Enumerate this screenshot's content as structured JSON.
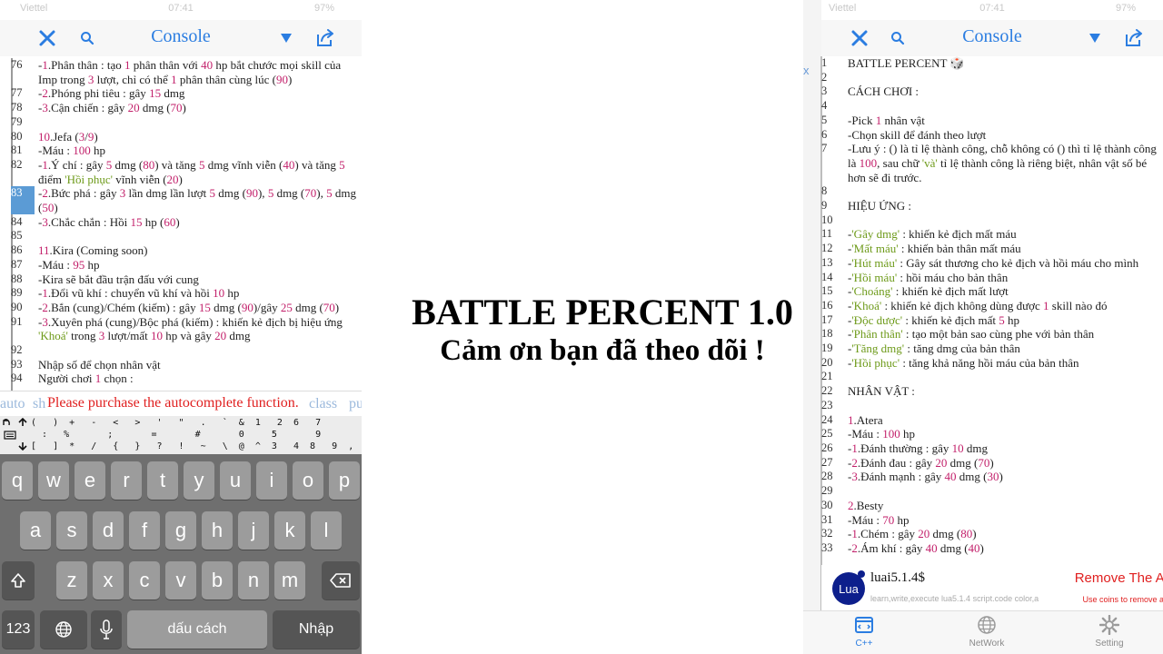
{
  "left": {
    "status": {
      "carrier": "Viettel",
      "time": "07:41",
      "battery": "97%"
    },
    "title": "Console",
    "lines": [
      {
        "n": "76",
        "parts": [
          [
            "-",
            ""
          ],
          [
            "1",
            "num"
          ],
          [
            ".Phân thân : tạo ",
            ""
          ],
          [
            "1",
            "num"
          ],
          [
            " phân thân với ",
            ""
          ],
          [
            "40",
            "num"
          ],
          [
            " hp bắt chước mọi skill của Imp trong ",
            ""
          ],
          [
            "3",
            "num"
          ],
          [
            " lượt, chỉ có thể ",
            ""
          ],
          [
            "1",
            "num"
          ],
          [
            " phân thân cùng lúc (",
            ""
          ],
          [
            "90",
            "num"
          ],
          [
            ")",
            ""
          ]
        ]
      },
      {
        "n": "77",
        "parts": [
          [
            "-",
            ""
          ],
          [
            "2",
            "num"
          ],
          [
            ".Phóng phi tiêu : gây ",
            ""
          ],
          [
            "15",
            "num"
          ],
          [
            " dmg",
            ""
          ]
        ]
      },
      {
        "n": "78",
        "parts": [
          [
            "-",
            ""
          ],
          [
            "3",
            "num"
          ],
          [
            ".Cận chiến : gây ",
            ""
          ],
          [
            "20",
            "num"
          ],
          [
            " dmg (",
            ""
          ],
          [
            "70",
            "num"
          ],
          [
            ")",
            ""
          ]
        ]
      },
      {
        "n": "79",
        "parts": []
      },
      {
        "n": "80",
        "parts": [
          [
            "10",
            "num"
          ],
          [
            ".Jefa (",
            ""
          ],
          [
            "3",
            "num"
          ],
          [
            "/",
            ""
          ],
          [
            "9",
            "num"
          ],
          [
            ")",
            ""
          ]
        ]
      },
      {
        "n": "81",
        "parts": [
          [
            "-Máu : ",
            ""
          ],
          [
            "100",
            "num"
          ],
          [
            " hp",
            ""
          ]
        ]
      },
      {
        "n": "82",
        "parts": [
          [
            "-",
            ""
          ],
          [
            "1",
            "num"
          ],
          [
            ".Ý chí : gây ",
            ""
          ],
          [
            "5",
            "num"
          ],
          [
            " dmg (",
            ""
          ],
          [
            "80",
            "num"
          ],
          [
            ") và tăng ",
            ""
          ],
          [
            "5",
            "num"
          ],
          [
            " dmg vĩnh viễn (",
            ""
          ],
          [
            "40",
            "num"
          ],
          [
            ") và tăng ",
            ""
          ],
          [
            "5",
            "num"
          ],
          [
            " điểm ",
            ""
          ],
          [
            "'Hồi phục'",
            "str"
          ],
          [
            " vĩnh viễn (",
            ""
          ],
          [
            "20",
            "num"
          ],
          [
            ")",
            ""
          ]
        ]
      },
      {
        "n": "83",
        "hl": true,
        "parts": [
          [
            "-",
            ""
          ],
          [
            "2",
            "num"
          ],
          [
            ".Bức phá : gây ",
            ""
          ],
          [
            "3",
            "num"
          ],
          [
            " lần dmg lần lượt ",
            ""
          ],
          [
            "5",
            "num"
          ],
          [
            " dmg (",
            ""
          ],
          [
            "90",
            "num"
          ],
          [
            "), ",
            ""
          ],
          [
            "5",
            "num"
          ],
          [
            " dmg (",
            ""
          ],
          [
            "70",
            "num"
          ],
          [
            "), ",
            ""
          ],
          [
            "5",
            "num"
          ],
          [
            " dmg (",
            ""
          ],
          [
            "50",
            "num"
          ],
          [
            ")",
            ""
          ]
        ]
      },
      {
        "n": "84",
        "parts": [
          [
            "-",
            ""
          ],
          [
            "3",
            "num"
          ],
          [
            ".Chắc chắn : Hồi ",
            ""
          ],
          [
            "15",
            "num"
          ],
          [
            " hp (",
            ""
          ],
          [
            "60",
            "num"
          ],
          [
            ")",
            ""
          ]
        ]
      },
      {
        "n": "85",
        "parts": []
      },
      {
        "n": "86",
        "parts": [
          [
            "11",
            "num"
          ],
          [
            ".Kira (Coming soon)",
            ""
          ]
        ]
      },
      {
        "n": "87",
        "parts": [
          [
            "-Máu : ",
            ""
          ],
          [
            "95",
            "num"
          ],
          [
            " hp",
            ""
          ]
        ]
      },
      {
        "n": "88",
        "parts": [
          [
            "-Kira sẽ bắt đầu trận đấu với cung",
            ""
          ]
        ]
      },
      {
        "n": "89",
        "parts": [
          [
            "-",
            ""
          ],
          [
            "1",
            "num"
          ],
          [
            ".Đổi vũ khí : chuyển vũ khí và hồi ",
            ""
          ],
          [
            "10",
            "num"
          ],
          [
            " hp",
            ""
          ]
        ]
      },
      {
        "n": "90",
        "parts": [
          [
            "-",
            ""
          ],
          [
            "2",
            "num"
          ],
          [
            ".Bắn (cung)/Chém (kiếm) : gây ",
            ""
          ],
          [
            "15",
            "num"
          ],
          [
            " dmg (",
            ""
          ],
          [
            "90",
            "num"
          ],
          [
            ")/gây ",
            ""
          ],
          [
            "25",
            "num"
          ],
          [
            " dmg (",
            ""
          ],
          [
            "70",
            "num"
          ],
          [
            ")",
            ""
          ]
        ]
      },
      {
        "n": "91",
        "parts": [
          [
            "-",
            ""
          ],
          [
            "3",
            "num"
          ],
          [
            ".Xuyên phá (cung)/Bộc phá (kiếm) : khiến kẻ địch bị hiệu ứng ",
            ""
          ],
          [
            "'Khoá'",
            "str"
          ],
          [
            " trong ",
            ""
          ],
          [
            "3",
            "num"
          ],
          [
            " lượt/mất ",
            ""
          ],
          [
            "10",
            "num"
          ],
          [
            " hp và gây ",
            ""
          ],
          [
            "20",
            "num"
          ],
          [
            " dmg",
            ""
          ]
        ]
      },
      {
        "n": "92",
        "parts": []
      },
      {
        "n": "93",
        "parts": [
          [
            "Nhập số để chọn nhân vật",
            ""
          ]
        ]
      },
      {
        "n": "94",
        "parts": [
          [
            "Người chơi ",
            ""
          ],
          [
            "1",
            "num"
          ],
          [
            " chọn :",
            ""
          ]
        ]
      }
    ],
    "autocomplete": {
      "words": [
        "auto",
        "sh",
        "class",
        "pu"
      ],
      "message": "Please purchase the autocomplete function."
    },
    "symbols": {
      "row1": "(   )  +   -   <   >   '   \"   .   `  &  1   2  6   7",
      "row2": "  :   %       ;       =       #       0     5       9",
      "row3": "[   ]  *   /   {   }   ?   !   ~   \\  @  ^  3   4  8   9  ,  ."
    },
    "keyboard": {
      "row1": [
        "q",
        "w",
        "e",
        "r",
        "t",
        "y",
        "u",
        "i",
        "o",
        "p"
      ],
      "row2": [
        "a",
        "s",
        "d",
        "f",
        "g",
        "h",
        "j",
        "k",
        "l"
      ],
      "row3": [
        "z",
        "x",
        "c",
        "v",
        "b",
        "n",
        "m"
      ],
      "numbers_key": "123",
      "space_key": "dấu cách",
      "return_key": "Nhập"
    }
  },
  "center": {
    "title": "BATTLE PERCENT 1.0",
    "subtitle": "Cảm ơn bạn đã theo dõi !"
  },
  "right": {
    "status": {
      "carrier": "Viettel",
      "time": "07:41",
      "battery": "97%"
    },
    "title": "Console",
    "side_x": "x",
    "lines": [
      {
        "n": "1",
        "parts": [
          [
            "BATTLE PERCENT 🎲",
            ""
          ]
        ]
      },
      {
        "n": "2",
        "parts": []
      },
      {
        "n": "3",
        "parts": [
          [
            "CÁCH CHƠI :",
            ""
          ]
        ]
      },
      {
        "n": "4",
        "parts": []
      },
      {
        "n": "5",
        "parts": [
          [
            "-Pick ",
            ""
          ],
          [
            "1",
            "num"
          ],
          [
            " nhân vật",
            ""
          ]
        ]
      },
      {
        "n": "6",
        "parts": [
          [
            "-Chọn skill để đánh theo lượt",
            ""
          ]
        ]
      },
      {
        "n": "7",
        "parts": [
          [
            "-Lưu ý : () là tỉ lệ thành công, chỗ không có () thì tỉ lệ thành công là ",
            ""
          ],
          [
            "100",
            "num"
          ],
          [
            ", sau chữ ",
            ""
          ],
          [
            "'và'",
            "str"
          ],
          [
            " tỉ lệ thành công là riêng biệt, nhân vật số bé hơn sẽ đi trước.",
            ""
          ]
        ]
      },
      {
        "n": "8",
        "parts": []
      },
      {
        "n": "9",
        "parts": [
          [
            "HIỆU ỨNG :",
            ""
          ]
        ]
      },
      {
        "n": "10",
        "parts": []
      },
      {
        "n": "11",
        "parts": [
          [
            "-",
            ""
          ],
          [
            "'Gây dmg'",
            "str"
          ],
          [
            " : khiến kẻ địch mất máu",
            ""
          ]
        ]
      },
      {
        "n": "12",
        "parts": [
          [
            "-",
            ""
          ],
          [
            "'Mất máu'",
            "str"
          ],
          [
            " : khiến bản thân mất máu",
            ""
          ]
        ]
      },
      {
        "n": "13",
        "parts": [
          [
            "-",
            ""
          ],
          [
            "'Hút máu'",
            "str"
          ],
          [
            " : Gây sát thương cho kẻ địch và hồi máu cho mình",
            ""
          ]
        ]
      },
      {
        "n": "14",
        "parts": [
          [
            "-",
            ""
          ],
          [
            "'Hồi máu'",
            "str"
          ],
          [
            " : hồi máu cho bản thân",
            ""
          ]
        ]
      },
      {
        "n": "15",
        "parts": [
          [
            "-",
            ""
          ],
          [
            "'Choáng'",
            "str"
          ],
          [
            " : khiến kẻ địch mất lượt",
            ""
          ]
        ]
      },
      {
        "n": "16",
        "parts": [
          [
            "-",
            ""
          ],
          [
            "'Khoá'",
            "str"
          ],
          [
            " : khiến kẻ địch không dùng được ",
            ""
          ],
          [
            "1",
            "num"
          ],
          [
            " skill nào đó",
            ""
          ]
        ]
      },
      {
        "n": "17",
        "parts": [
          [
            "-",
            ""
          ],
          [
            "'Độc dược'",
            "str"
          ],
          [
            " : khiến kẻ địch mất ",
            ""
          ],
          [
            "5",
            "num"
          ],
          [
            " hp",
            ""
          ]
        ]
      },
      {
        "n": "18",
        "parts": [
          [
            "-",
            ""
          ],
          [
            "'Phân thân'",
            "str"
          ],
          [
            " : tạo một bản sao cùng phe với bản thân",
            ""
          ]
        ]
      },
      {
        "n": "19",
        "parts": [
          [
            "-",
            ""
          ],
          [
            "'Tăng dmg'",
            "str"
          ],
          [
            " : tăng dmg của bản thân",
            ""
          ]
        ]
      },
      {
        "n": "20",
        "parts": [
          [
            "-",
            ""
          ],
          [
            "'Hồi phục'",
            "str"
          ],
          [
            " : tăng khả năng hồi máu của bản thân",
            ""
          ]
        ]
      },
      {
        "n": "21",
        "parts": []
      },
      {
        "n": "22",
        "parts": [
          [
            "NHÂN VẬT :",
            ""
          ]
        ]
      },
      {
        "n": "23",
        "parts": []
      },
      {
        "n": "24",
        "parts": [
          [
            "1",
            "num"
          ],
          [
            ".Atera",
            ""
          ]
        ]
      },
      {
        "n": "25",
        "parts": [
          [
            "-Máu : ",
            ""
          ],
          [
            "100",
            "num"
          ],
          [
            " hp",
            ""
          ]
        ]
      },
      {
        "n": "26",
        "parts": [
          [
            "-",
            ""
          ],
          [
            "1",
            "num"
          ],
          [
            ".Đánh thường : gây ",
            ""
          ],
          [
            "10",
            "num"
          ],
          [
            " dmg",
            ""
          ]
        ]
      },
      {
        "n": "27",
        "parts": [
          [
            "-",
            ""
          ],
          [
            "2",
            "num"
          ],
          [
            ".Đánh đau : gây ",
            ""
          ],
          [
            "20",
            "num"
          ],
          [
            " dmg (",
            ""
          ],
          [
            "70",
            "num"
          ],
          [
            ")",
            ""
          ]
        ]
      },
      {
        "n": "28",
        "parts": [
          [
            "-",
            ""
          ],
          [
            "3",
            "num"
          ],
          [
            ".Đánh mạnh : gây ",
            ""
          ],
          [
            "40",
            "num"
          ],
          [
            " dmg (",
            ""
          ],
          [
            "30",
            "num"
          ],
          [
            ")",
            ""
          ]
        ]
      },
      {
        "n": "29",
        "parts": []
      },
      {
        "n": "30",
        "parts": [
          [
            "2",
            "num"
          ],
          [
            ".Besty",
            ""
          ]
        ]
      },
      {
        "n": "31",
        "parts": [
          [
            "-Máu : ",
            ""
          ],
          [
            "70",
            "num"
          ],
          [
            " hp",
            ""
          ]
        ]
      },
      {
        "n": "32",
        "parts": [
          [
            "-",
            ""
          ],
          [
            "1",
            "num"
          ],
          [
            ".Chém : gây ",
            ""
          ],
          [
            "20",
            "num"
          ],
          [
            " dmg (",
            ""
          ],
          [
            "80",
            "num"
          ],
          [
            ")",
            ""
          ]
        ]
      },
      {
        "n": "33",
        "parts": [
          [
            "-",
            ""
          ],
          [
            "2",
            "num"
          ],
          [
            ".Ám khí : gây ",
            ""
          ],
          [
            "40",
            "num"
          ],
          [
            " dmg (",
            ""
          ],
          [
            "40",
            "num"
          ],
          [
            ")",
            ""
          ]
        ]
      }
    ],
    "ad": {
      "logo_text": "Lua",
      "title": "luai5.1.4$",
      "subtitle": "learn,write,execute lua5.1.4 script.code color,a",
      "remove_label": "Remove The Ad",
      "coins_label": "Use coins to remove ad"
    },
    "tabs": [
      {
        "label": "C++",
        "active": true
      },
      {
        "label": "NetWork",
        "active": false
      },
      {
        "label": "Setting",
        "active": false
      }
    ],
    "colors": {
      "accent": "#2b7de1",
      "number": "#c21f6a",
      "string": "#6d9a19",
      "error": "#e02020"
    }
  }
}
